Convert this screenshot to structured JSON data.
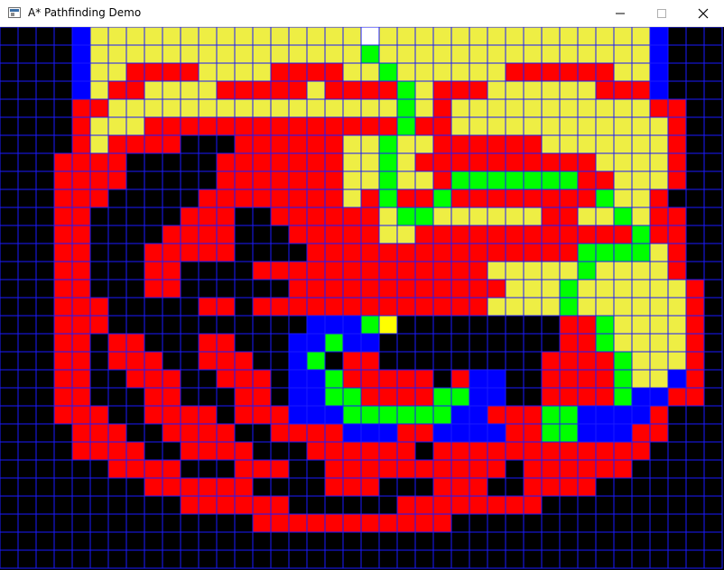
{
  "window": {
    "title": "A* Pathfinding Demo",
    "controls": {
      "minimize_icon": "minimize-icon",
      "maximize_icon": "maximize-icon",
      "close_icon": "close-icon"
    }
  },
  "colors": {
    "background": "#000000",
    "grid_line": "#1a1aff",
    "wall": "#000000",
    "open": "#eeee44",
    "closed": "#ff0000",
    "path": "#00ff00",
    "start": "#ffffff",
    "goal": "#ffff00",
    "frontier": "#0000ff"
  },
  "legend_keys": {
    ".": "wall",
    "Y": "open",
    "R": "closed",
    "G": "path",
    "B": "frontier",
    "W": "start",
    "T": "goal"
  },
  "grid": {
    "cols": 40,
    "rows": 30,
    "cells": [
      "....BYYYYYYYYYYYYYYYWYYYYYYYYYYYYYYYB...",
      "....BYYYYYYYYYYYYYYYGYYYYYYYYYYYYYYYB...",
      "....BYYRRRRYYYYRRRRYYGYYYYYYRRRRRRYYB...",
      "....BYRRYYYYRRRRRYRRRRGYRRRYYYYYYRRRB...",
      "....RRYYYYYYYYYYYYYYYYGYRYYYYYYYYYYYRR..",
      "....RYYYRRRRRRRRRRRRRRGRRYYYYYYYYYYYYR..",
      "....RYRRRR...RRRRRRYYGYYRRRRRRYYYYYYYR..",
      "...RRRR.....RRRRRRRYYGYRRRRRRRRRRYYYYR..",
      "...RRRR.....RRRRRRRYYGYYRGGGGGGGRRYYYR..",
      "...RRR.....RRRRRRRRYRGRRGRRRRRRRRGYYR...",
      "...RR.....RRR..RRRRRRYGGYYYYYYRRYYGYRR..",
      "...RR....RRRR...RRRRRYYRRRRRRRRRRRRGRR..",
      "...RR...RRRRR....RRRRRRRRRRRRRRRGGGGYR..",
      "...RR...RR....RRRRRRRRRRRRRYYYYYGYYYYR..",
      "...RR...RR......RRRRRRRRRRRRYYYGYYYYYYR.",
      "...RRR.....RR.RRRRRRRRRRRRRYYYYGYYYYYYR.",
      "...RRR...........BBBGT.........RRGYYYYR.",
      "...RR.RR...RR...BBGBB..........RRGYYYYR.",
      "...RR.RRR..RRR..BG.RR.........RRRRGYYYR.",
      "...RR..RRR..RRR.BBGRRRRR.RBB..RRRRGYYBR.",
      "...RR...RR...RR.BBGGRRRRGGBB..RRRRGBBRR.",
      "...RRR..RRRR.RRRBBBGGGGGGBBRRRGGBBBBR...",
      "....RRR..RRRR..RRRRBBBRRBBBBRRGGBBBRR...",
      "....RRRR..RRRR...RRRRRR.RRRRRRRRRRRR....",
      "......RRRR...RRR..RRRRRRRRRR.RRRRRR.....",
      "........RRRRRR....RRR...RRR..RRRR.......",
      "..........RRRRRR......RRRRRRRR..........",
      "..............RRRRRRRRRRR...............",
      "........................................",
      "........................................"
    ]
  }
}
